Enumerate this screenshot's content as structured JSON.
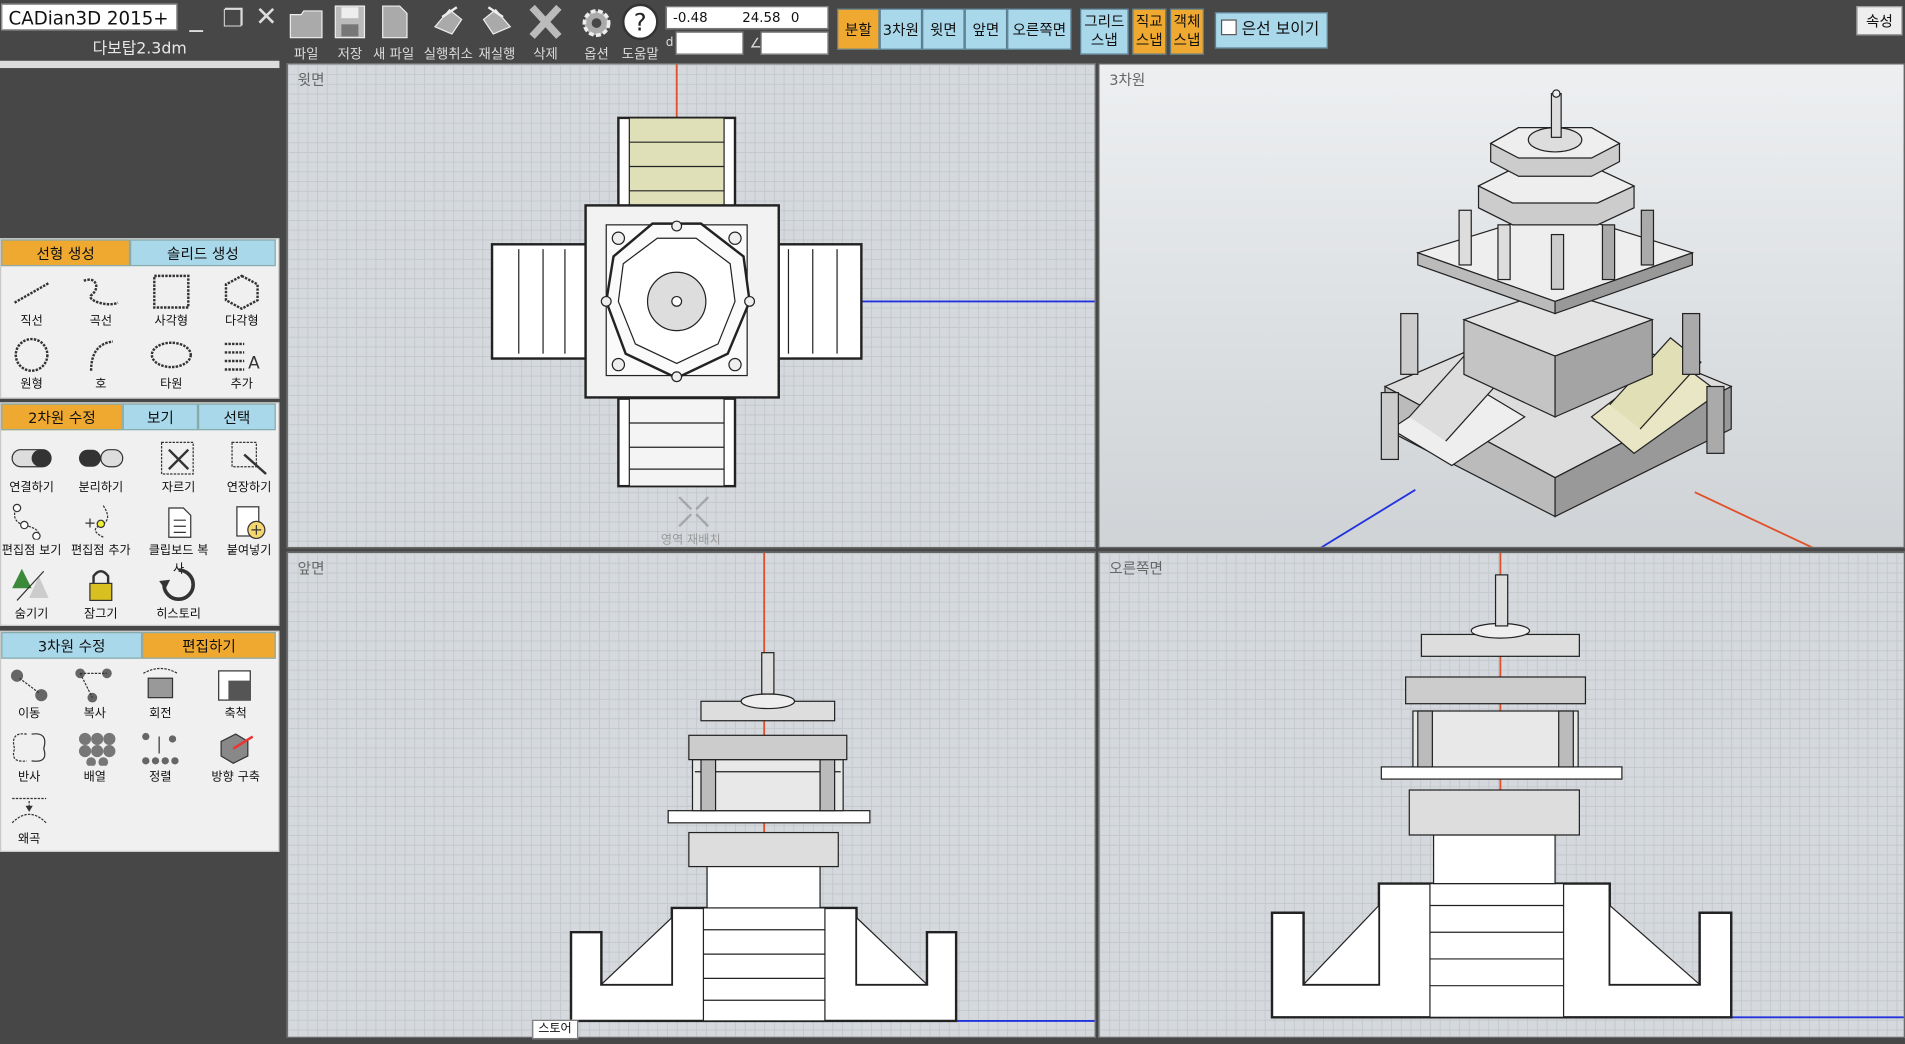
{
  "app": {
    "title": "CADian3D 2015+",
    "filename": "다보탑2.3dm"
  },
  "window_controls": {
    "minimize": "_",
    "restore": "❐",
    "close": "✕"
  },
  "toolbar": {
    "file": "파일",
    "save": "저장",
    "new_file": "새 파일",
    "undo": "실행취소",
    "redo": "재실행",
    "delete": "삭제",
    "options": "옵션",
    "help": "도움말"
  },
  "coords": {
    "x": "-0.48",
    "y": "24.58",
    "z": "0",
    "dist_symbol": "d",
    "angle_symbol": "∠",
    "dist_value": "",
    "angle_value": ""
  },
  "view_buttons": {
    "split": "분할",
    "three_d": "3차원",
    "top": "윗면",
    "front": "앞면",
    "right": "오른쪽면"
  },
  "snap_buttons": {
    "grid1": "그리드",
    "grid2": "스냅",
    "ortho1": "직교",
    "ortho2": "스냅",
    "obj1": "객체",
    "obj2": "스냅"
  },
  "hidden_lines": {
    "label": "은선 보이기",
    "checked": false
  },
  "properties_button": "속성",
  "panel_linear": {
    "tabs": [
      "선형 생성",
      "솔리드 생성"
    ],
    "tools": [
      "직선",
      "곡선",
      "사각형",
      "다각형",
      "원형",
      "호",
      "타원",
      "추가"
    ]
  },
  "panel_2d": {
    "tabs": [
      "2차원 수정",
      "보기",
      "선택"
    ],
    "tools": [
      "연결하기",
      "분리하기",
      "자르기",
      "연장하기",
      "편집점 보기",
      "편집점 추가",
      "클립보드 복사",
      "붙여넣기",
      "숨기기",
      "잠그기",
      "히스토리"
    ]
  },
  "panel_3d": {
    "tabs": [
      "3차원 수정",
      "편집하기"
    ],
    "tools": [
      "이동",
      "복사",
      "회전",
      "축척",
      "반사",
      "배열",
      "정렬",
      "방향 구축",
      "왜곡"
    ]
  },
  "viewports": {
    "top": "윗면",
    "three_d": "3차원",
    "front": "앞면",
    "right": "오른쪽면"
  },
  "rearrange_label": "영역 재배치",
  "tooltip": "스토어",
  "colors": {
    "accent_orange": "#f0a930",
    "accent_blue": "#a9d8ea",
    "axis_red": "#e0502a",
    "axis_blue": "#2233dd",
    "background": "#474747"
  }
}
